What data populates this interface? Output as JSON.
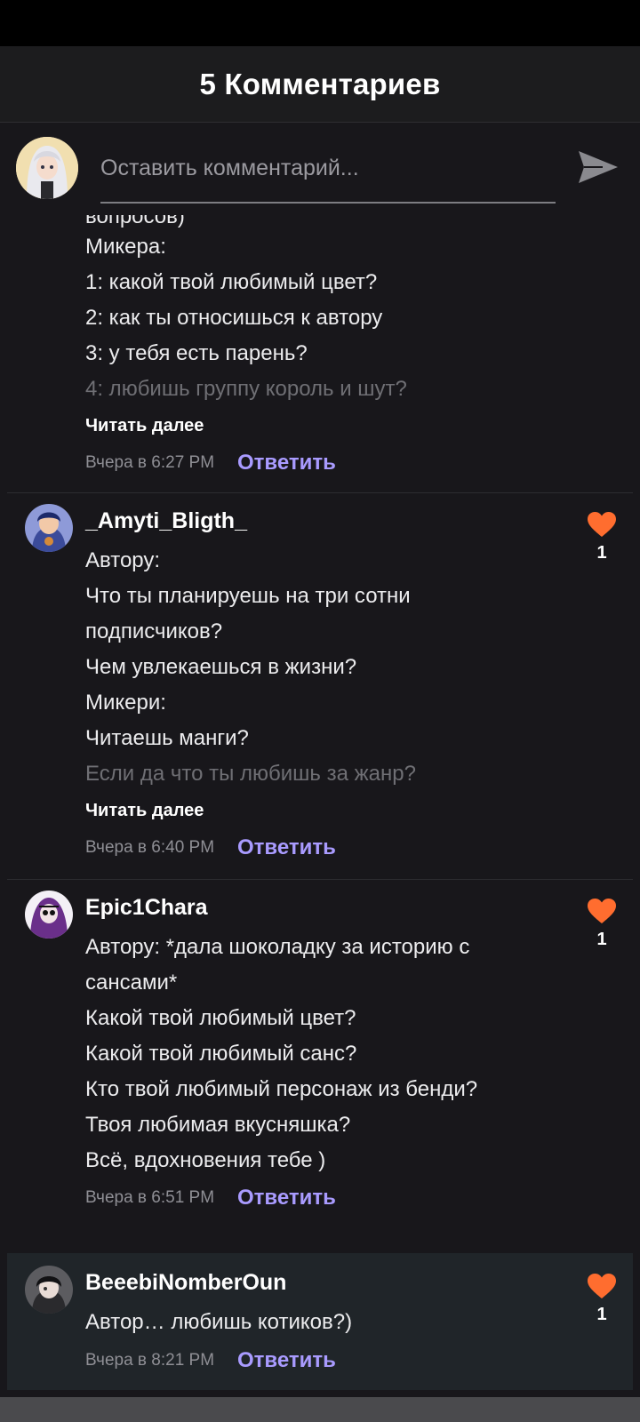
{
  "header": {
    "title": "5 Комментариев"
  },
  "compose": {
    "placeholder": "Оставить комментарий...",
    "send_icon": "send-icon"
  },
  "colors": {
    "accent": "#a99bff",
    "heart": "#ff6d2f",
    "background": "#18171b"
  },
  "comments": [
    {
      "lines": [
        "вопросов)",
        "Микера:",
        "1: какой твой любимый цвет?",
        "2: как ты относишься к автору",
        "3: у тебя есть парень?",
        "4: любишь группу король и шут?"
      ],
      "read_more": "Читать далее",
      "time": "Вчера в 6:27 PM",
      "reply": "Ответить"
    },
    {
      "username": "_Amyti_Bligth_",
      "lines": [
        "Автору:",
        "Что ты планируешь на три сотни",
        "подписчиков?",
        "Чем увлекаешься в жизни?",
        "Микери:",
        "Читаешь манги?",
        "Если да что ты любишь за жанр?"
      ],
      "read_more": "Читать далее",
      "time": "Вчера в 6:40 PM",
      "reply": "Ответить",
      "likes": "1"
    },
    {
      "username": "Epic1Chara",
      "lines": [
        "Автору: *дала шоколадку за историю с",
        "сансами*",
        "Какой твой любимый цвет?",
        "Какой твой любимый санс?",
        "Кто твой любимый персонаж из бенди?",
        "Твоя любимая вкусняшка?",
        "Всё, вдохновения тебе )"
      ],
      "time": "Вчера в 6:51 PM",
      "reply": "Ответить",
      "likes": "1"
    },
    {
      "username": "BeeebiNomberOun",
      "lines": [
        "Автор… любишь котиков?)"
      ],
      "time": "Вчера в 8:21 PM",
      "reply": "Ответить",
      "likes": "1"
    }
  ]
}
